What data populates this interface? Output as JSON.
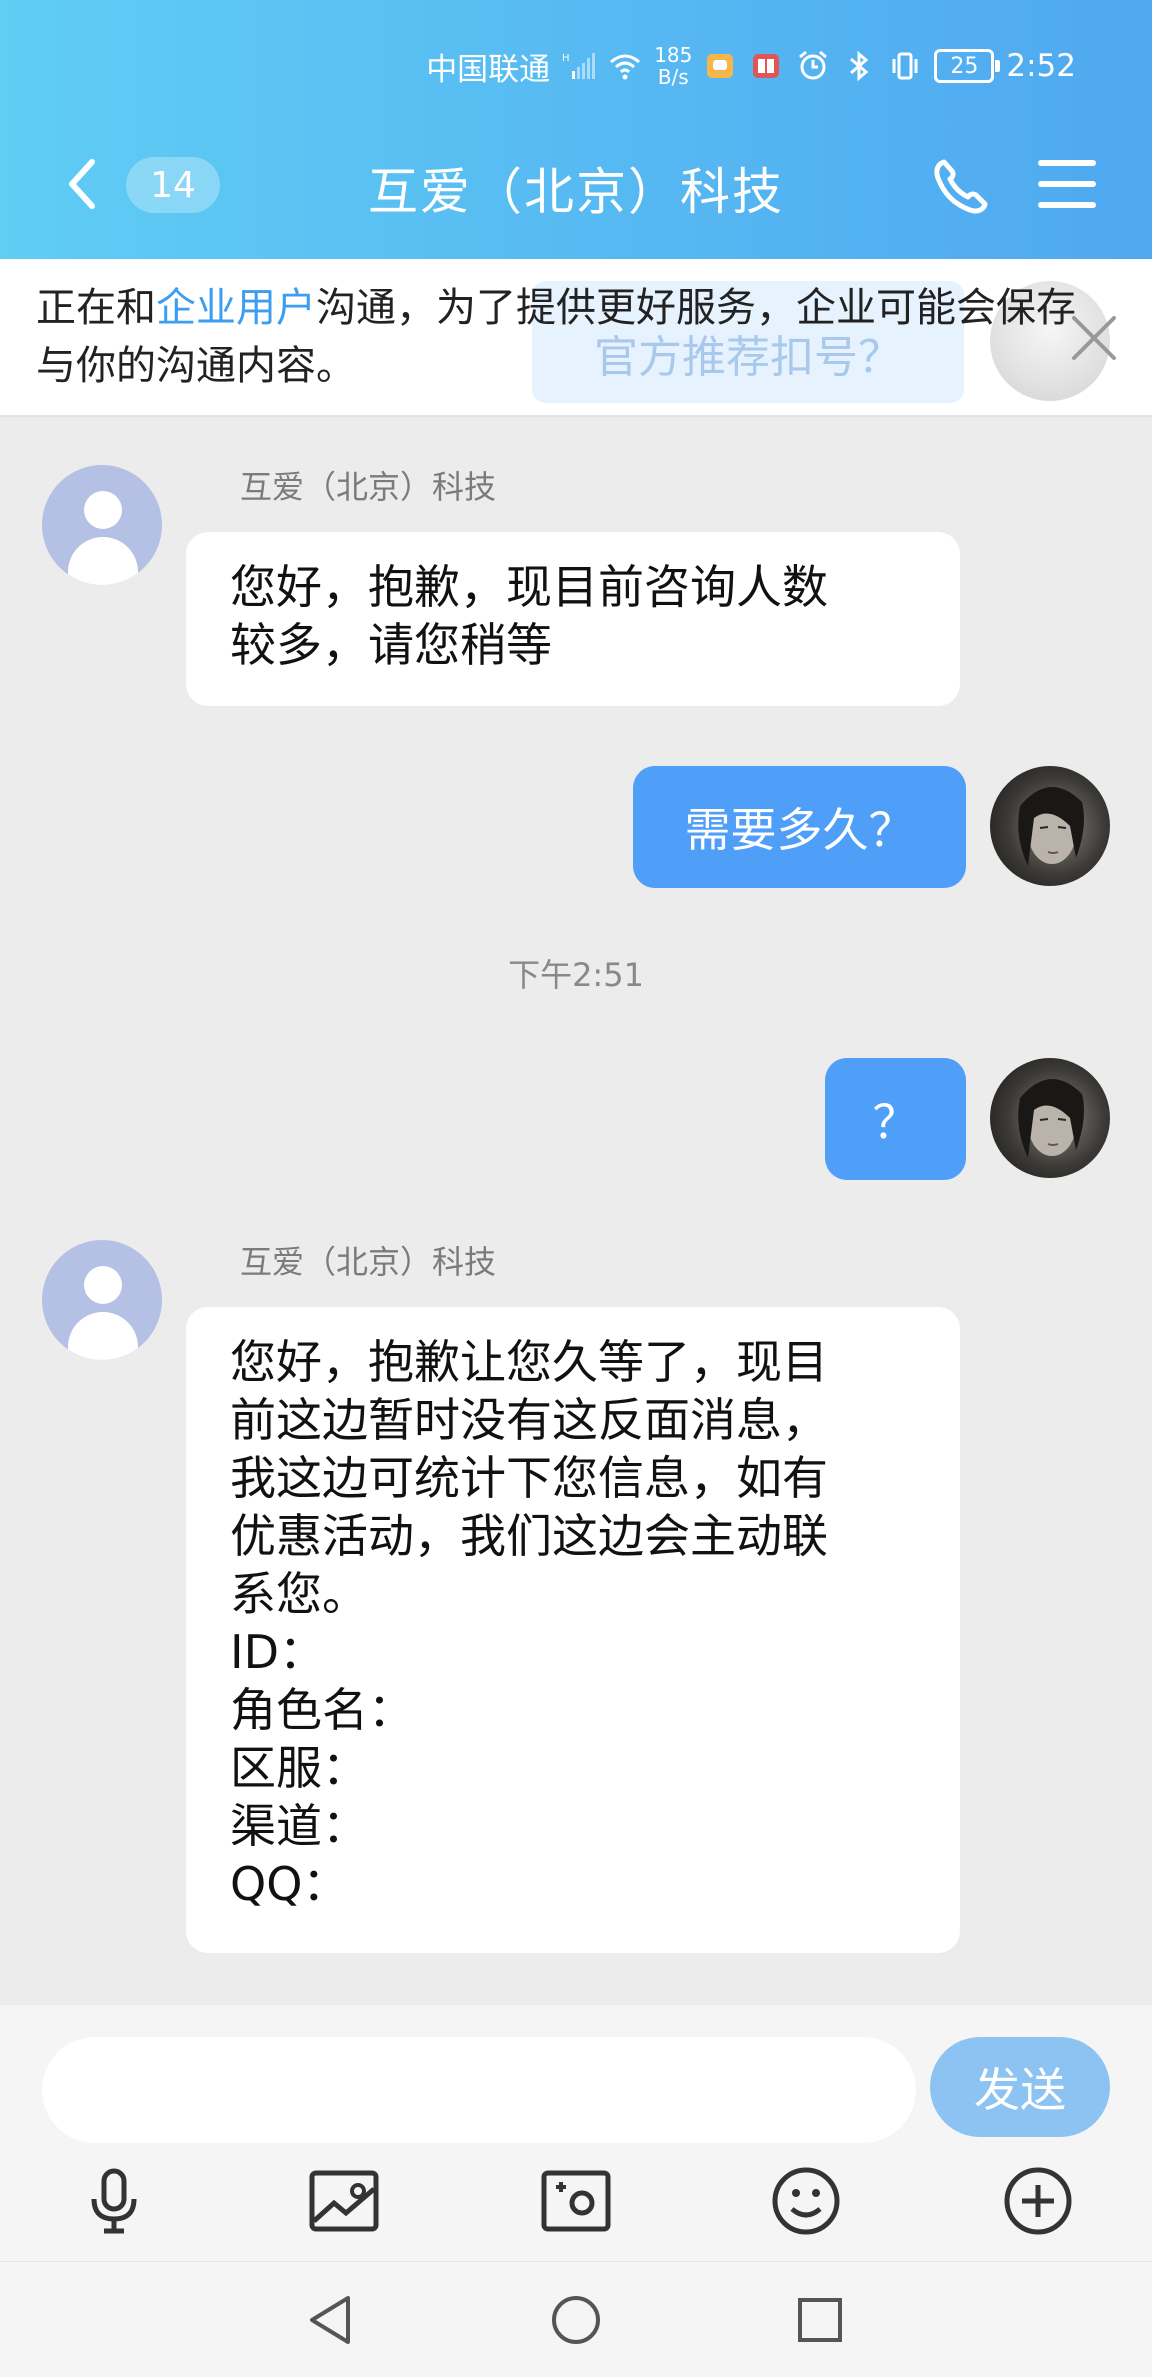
{
  "status_bar": {
    "carrier": "中国联通",
    "speed_value": "185",
    "speed_unit": "B/s",
    "battery": "25",
    "time": "2:52",
    "icons": [
      "signal-icon",
      "wifi-icon",
      "app-icon-orange",
      "app-icon-red",
      "alarm-icon",
      "bluetooth-icon",
      "vibrate-icon",
      "battery-icon"
    ]
  },
  "header": {
    "back_label": "back",
    "unread_count": "14",
    "title": "互爱（北京）科技",
    "icons": [
      "back-icon",
      "phone-icon",
      "menu-icon"
    ]
  },
  "notice": {
    "prefix": "正在和",
    "highlight": "企业用户",
    "suffix": "沟通，为了提供更好服务，企业可能会保存与你的沟通内容。",
    "ghost_text": "官方推荐扣号？"
  },
  "messages": [
    {
      "side": "in",
      "sender": "互爱（北京）科技",
      "text": "您好，抱歉，现目前咨询人数\n较多，请您稍等"
    },
    {
      "side": "out",
      "text": "需要多久？"
    },
    {
      "side": "time",
      "text": "下午2:51"
    },
    {
      "side": "out",
      "text": "？"
    },
    {
      "side": "in",
      "sender": "互爱（北京）科技",
      "text": "您好，抱歉让您久等了，现目\n前这边暂时没有这反面消息，\n我这边可统计下您信息，如有\n优惠活动，我们这边会主动联\n系您。\nID：\n角色名：\n区服：\n渠道：\nQQ："
    }
  ],
  "input": {
    "value": "",
    "placeholder": "",
    "send_label": "发送"
  },
  "toolbar": {
    "icons": [
      "microphone-icon",
      "image-icon",
      "camera-icon",
      "emoji-icon",
      "plus-icon"
    ]
  },
  "navbar": {
    "icons": [
      "back-triangle-icon",
      "home-circle-icon",
      "recents-square-icon"
    ]
  },
  "colors": {
    "header_gradient_start": "#5fcdf4",
    "header_gradient_end": "#4fa8f0",
    "bubble_out": "#4f9ef7",
    "bubble_in": "#ffffff",
    "background": "#ececec",
    "highlight": "#3c9ef0",
    "send_button": "#8dc3f3"
  }
}
